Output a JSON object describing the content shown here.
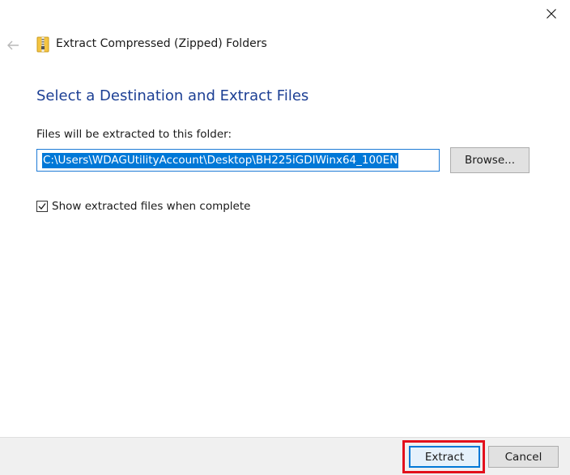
{
  "window": {
    "title": "Extract Compressed (Zipped) Folders"
  },
  "main": {
    "heading": "Select a Destination and Extract Files",
    "folder_label": "Files will be extracted to this folder:",
    "path_value": "C:\\Users\\WDAGUtilityAccount\\Desktop\\BH225iGDIWinx64_100EN",
    "browse_label": "Browse...",
    "show_files_label": "Show extracted files when complete",
    "show_files_checked": true
  },
  "footer": {
    "extract_label": "Extract",
    "cancel_label": "Cancel"
  },
  "icons": {
    "back": "back-arrow-icon",
    "folder": "zip-folder-icon",
    "close": "close-icon",
    "check": "checkmark-icon"
  },
  "colors": {
    "heading": "#1c3f94",
    "selection": "#0078d7",
    "highlight": "#e3101c",
    "footer": "#f0f0f0"
  }
}
